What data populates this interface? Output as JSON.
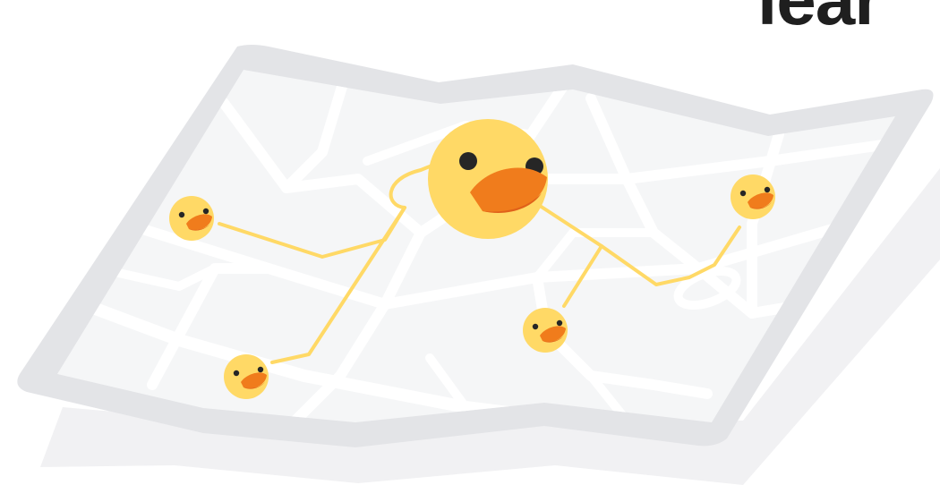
{
  "heading": {
    "text": "lear",
    "color": "#1f1f1f"
  },
  "colors": {
    "shadow": "#f1f1f3",
    "map_frame": "#e3e4e7",
    "map_paper": "#f5f6f7",
    "roads": "#ffffff",
    "route_line": "#ffd966",
    "duck_body": "#ffd966",
    "duck_bill": "#f07c1c",
    "duck_bill_dark": "#e0611a",
    "duck_eye": "#262626"
  },
  "map": {
    "icon": "folded-map",
    "hub": {
      "icon": "duck-head"
    },
    "nodes": [
      {
        "name": "left",
        "icon": "duck-head"
      },
      {
        "name": "bottom-left",
        "icon": "duck-head"
      },
      {
        "name": "center",
        "icon": "duck-head"
      },
      {
        "name": "right",
        "icon": "duck-head"
      }
    ]
  }
}
